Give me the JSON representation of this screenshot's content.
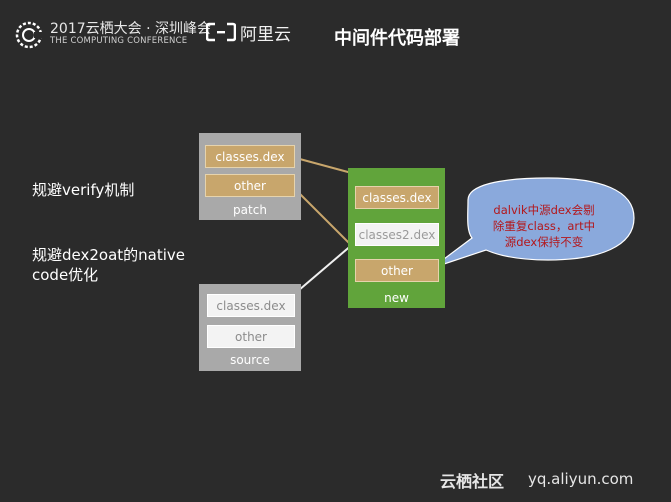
{
  "header": {
    "conference_title": "2017云栖大会 · 深圳峰会",
    "conference_subtitle": "THE COMPUTING CONFERENCE",
    "aliyun_name": "阿里云",
    "slide_title": "中间件代码部署"
  },
  "notes": [
    "规避verify机制",
    "规避dex2oat的native",
    "code优化"
  ],
  "diagram": {
    "patch": {
      "label": "patch",
      "items": [
        "classes.dex",
        "other"
      ]
    },
    "source": {
      "label": "source",
      "items": [
        "classes.dex",
        "other"
      ]
    },
    "new": {
      "label": "new",
      "items": [
        "classes.dex",
        "classes2.dex",
        "other"
      ]
    }
  },
  "callout": {
    "lines": [
      "dalvik中源dex会剔",
      "除重复class，art中",
      "源dex保持不变"
    ]
  },
  "watermark": {
    "brand": "云栖社区",
    "url": "yq.aliyun.com"
  },
  "colors": {
    "background": "#2b2b2b",
    "box_gray": "#a9a9a9",
    "box_green": "#61a43b",
    "cell_tan": "#c8a66c",
    "callout_blue": "#8aa9dc",
    "callout_text": "#b3171b"
  }
}
